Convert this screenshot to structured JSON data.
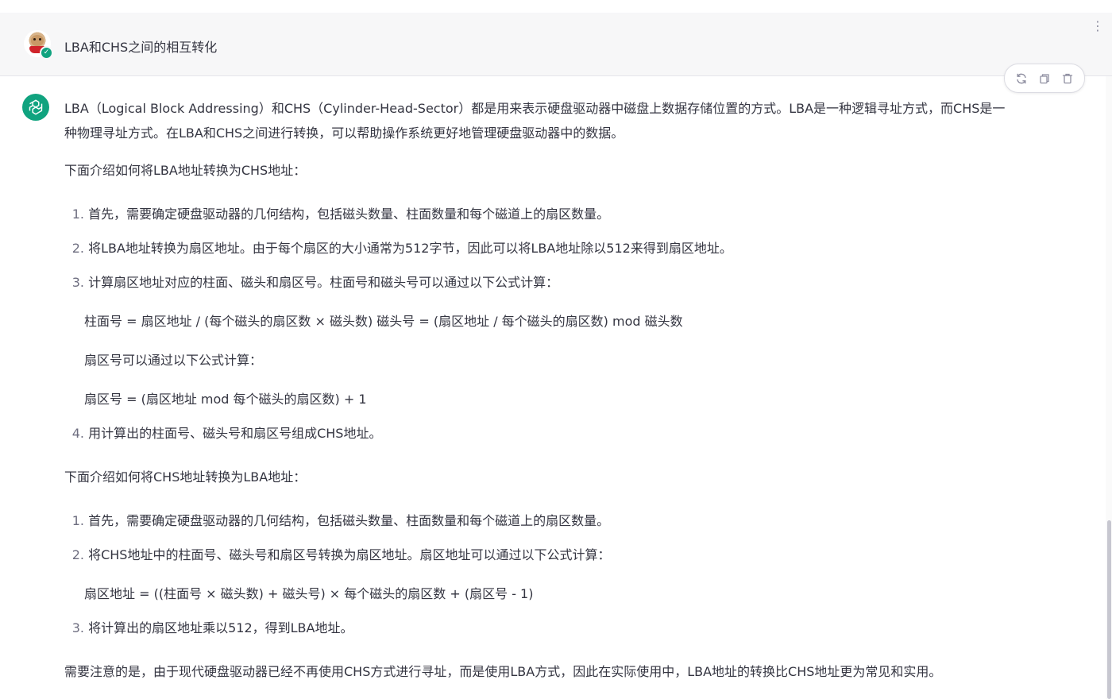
{
  "user_message": {
    "text": "LBA和CHS之间的相互转化",
    "avatar": "pug-avatar",
    "badge": "verified-check-icon"
  },
  "actions": {
    "regenerate": "refresh-icon",
    "copy": "copy-icon",
    "delete": "trash-icon"
  },
  "assistant": {
    "intro_line1": "LBA（Logical Block Addressing）和CHS（Cylinder-Head-Sector）都是用来表示硬盘驱动器中磁盘上数据存储位置的方式。LBA是一种逻辑寻址方式，而CHS是一",
    "intro_line2": "种物理寻址方式。在LBA和CHS之间进行转换，可以帮助操作系统更好地管理硬盘驱动器中的数据。",
    "lba_to_chs_heading": "下面介绍如何将LBA地址转换为CHS地址：",
    "lba_to_chs_steps": [
      {
        "num": "1.",
        "text": "首先，需要确定硬盘驱动器的几何结构，包括磁头数量、柱面数量和每个磁道上的扇区数量。"
      },
      {
        "num": "2.",
        "text": "将LBA地址转换为扇区地址。由于每个扇区的大小通常为512字节，因此可以将LBA地址除以512来得到扇区地址。"
      },
      {
        "num": "3.",
        "text": "计算扇区地址对应的柱面、磁头和扇区号。柱面号和磁头号可以通过以下公式计算："
      },
      {
        "num": "4.",
        "text": "用计算出的柱面号、磁头号和扇区号组成CHS地址。"
      }
    ],
    "formula_cyl_head": "柱面号 = 扇区地址 / (每个磁头的扇区数 × 磁头数) 磁头号 = (扇区地址 / 每个磁头的扇区数) mod 磁头数",
    "sector_note": "扇区号可以通过以下公式计算：",
    "formula_sector": "扇区号 = (扇区地址 mod 每个磁头的扇区数) + 1",
    "chs_to_lba_heading": "下面介绍如何将CHS地址转换为LBA地址：",
    "chs_to_lba_steps": [
      {
        "num": "1.",
        "text": "首先，需要确定硬盘驱动器的几何结构，包括磁头数量、柱面数量和每个磁道上的扇区数量。"
      },
      {
        "num": "2.",
        "text": "将CHS地址中的柱面号、磁头号和扇区号转换为扇区地址。扇区地址可以通过以下公式计算："
      },
      {
        "num": "3.",
        "text": "将计算出的扇区地址乘以512，得到LBA地址。"
      }
    ],
    "formula_sector_addr": "扇区地址 = ((柱面号 × 磁头数) + 磁头号) × 每个磁头的扇区数 + (扇区号 - 1)",
    "conclusion": "需要注意的是，由于现代硬盘驱动器已经不再使用CHS方式进行寻址，而是使用LBA方式，因此在实际使用中，LBA地址的转换比CHS地址更为常见和实用。"
  },
  "colors": {
    "brand_green": "#10a37f",
    "user_row_bg": "#f7f7f8",
    "text": "#343541"
  }
}
